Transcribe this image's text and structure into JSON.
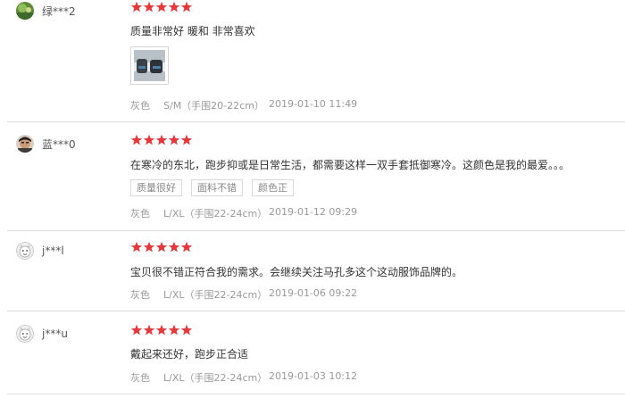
{
  "reviews": [
    {
      "user": "绿***2",
      "avatar": "green-photo-avatar",
      "rating": 5,
      "text": "质量非常好 暖和 非常喜欢",
      "has_photo": true,
      "color": "灰色",
      "size": "S/M（手围20-22cm）",
      "date": "2019-01-10 11:49"
    },
    {
      "user": "蓝***0",
      "avatar": "person-photo-avatar",
      "rating": 5,
      "text": "在寒冷的东北，跑步抑或是日常生活，都需要这样一双手套抵御寒冷。这颜色是我的最爱。。。",
      "tags": [
        "质量很好",
        "面料不错",
        "颜色正"
      ],
      "color": "灰色",
      "size": "L/XL（手围22-24cm）",
      "date": "2019-01-12 09:29"
    },
    {
      "user": "j***l",
      "avatar": "default-avatar",
      "rating": 5,
      "text": "宝贝很不错正符合我的需求。会继续关注马孔多这个这动服饰品牌的。",
      "color": "灰色",
      "size": "L/XL（手围22-24cm）",
      "date": "2019-01-06 09:22"
    },
    {
      "user": "j***u",
      "avatar": "default-avatar",
      "rating": 5,
      "text": "戴起来还好，跑步正合适",
      "color": "灰色",
      "size": "L/XL（手围22-24cm）",
      "date": "2019-01-03 10:12"
    }
  ],
  "colors": {
    "star": "#e4393c",
    "divider": "#dcdcdc",
    "meta": "#999999"
  }
}
